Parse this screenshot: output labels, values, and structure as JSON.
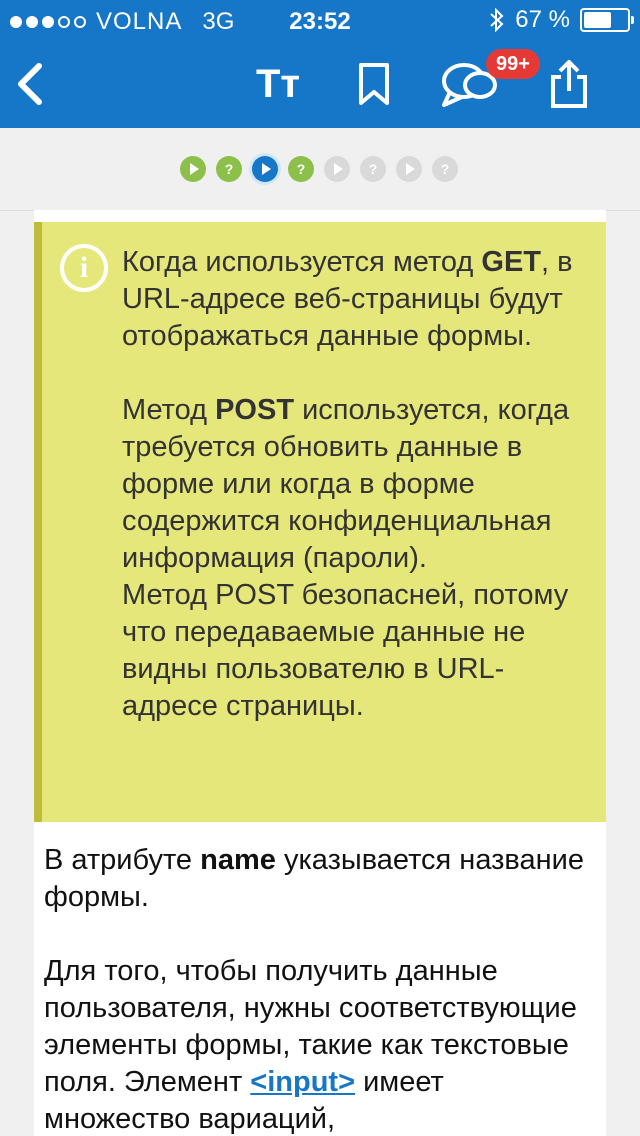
{
  "status": {
    "carrier": "VOLNA",
    "network": "3G",
    "time": "23:52",
    "battery": "67 %",
    "battery_level": 0.67
  },
  "nav": {
    "tt_label": "Tт",
    "badge": "99+"
  },
  "progress": [
    {
      "state": "play",
      "color": "green"
    },
    {
      "state": "?",
      "color": "green"
    },
    {
      "state": "play",
      "color": "blue"
    },
    {
      "state": "?",
      "color": "green"
    },
    {
      "state": "play",
      "color": "grey"
    },
    {
      "state": "?",
      "color": "grey"
    },
    {
      "state": "play",
      "color": "grey"
    },
    {
      "state": "?",
      "color": "grey"
    }
  ],
  "note": {
    "get_pre": "Когда используется метод ",
    "get_bold": "GET",
    "get_post": ", в URL-адресе веб-страницы будут отображаться данные формы.",
    "post_pre": "Метод ",
    "post_bold": "POST",
    "post_post": " используется, когда требуется обновить данные в форме или когда в форме содержится конфиденциальная информация (пароли).",
    "post_safety": "Метод POST безопасней, потому что передаваемые данные не видны пользователю в URL-адресе страницы."
  },
  "body": {
    "p1_pre": "В атрибуте ",
    "p1_bold": "name",
    "p1_post": " указывается название формы.",
    "p2_pre": "Для того, чтобы получить данные пользователя, нужны соответствующие элементы формы, такие как текстовые поля. Элемент ",
    "p2_link": "<input>",
    "p2_post": " имеет множество вариаций,"
  },
  "colors": {
    "bar": "#1677c8",
    "note_bg": "#e6e77a",
    "badge": "#e53935",
    "progress_green": "#8cc04a"
  }
}
